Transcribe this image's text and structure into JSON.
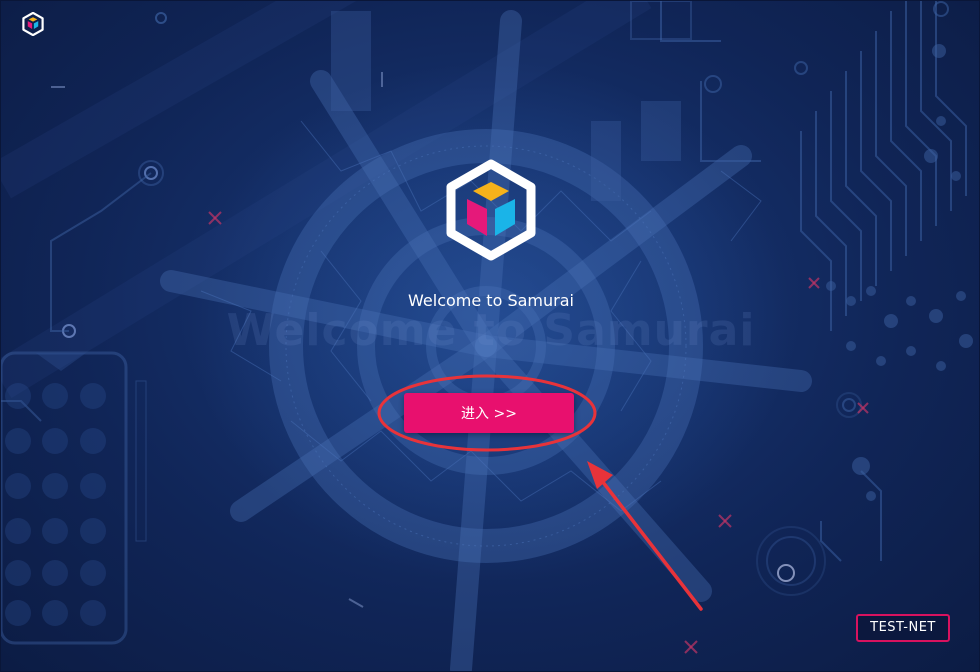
{
  "app": {
    "welcome_text": "Welcome to Samurai",
    "watermark_text": "Welcome to Samurai",
    "enter_button_label": "进入 >>",
    "network_badge": "TEST-NET"
  },
  "theme": {
    "background": "#102557",
    "accent": "#e8106e",
    "logo_colors": {
      "outline": "#ffffff",
      "yellow": "#f5b21b",
      "pink": "#e5197a",
      "cyan": "#1ab4e8"
    },
    "annotation": "#e8333a"
  }
}
